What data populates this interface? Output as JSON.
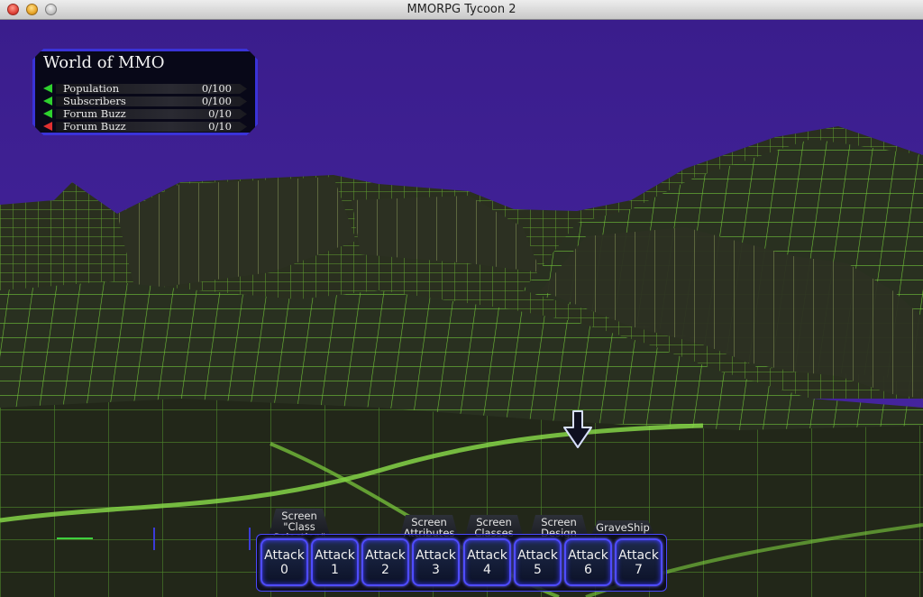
{
  "window": {
    "title": "MMORPG Tycoon 2"
  },
  "stats_panel": {
    "title": "World of MMO",
    "rows": [
      {
        "label": "Population",
        "value": "0/100",
        "trend": "up"
      },
      {
        "label": "Subscribers",
        "value": "0/100",
        "trend": "up"
      },
      {
        "label": "Forum Buzz",
        "value": "0/10",
        "trend": "up"
      },
      {
        "label": "Forum Buzz",
        "value": "0/10",
        "trend": "down"
      }
    ]
  },
  "tabs": [
    {
      "label": "Screen \"Class Selection\""
    },
    {
      "label": "Screen Attributes"
    },
    {
      "label": "Screen Classes"
    },
    {
      "label": "Screen Design"
    },
    {
      "label": "GraveShip"
    }
  ],
  "action_bar": [
    {
      "label": "Attack 0"
    },
    {
      "label": "Attack 1"
    },
    {
      "label": "Attack 2"
    },
    {
      "label": "Attack 3"
    },
    {
      "label": "Attack 4"
    },
    {
      "label": "Attack 5"
    },
    {
      "label": "Attack 6"
    },
    {
      "label": "Attack 7"
    }
  ],
  "colors": {
    "sky": "#3d1f93",
    "terrain": "#262a1c",
    "grid": "#7fdc3c",
    "ui_border": "#4b48ff",
    "trend_up": "#2ed12e",
    "trend_down": "#e23030"
  },
  "icons": {
    "cursor": "arrow-cursor-icon"
  }
}
